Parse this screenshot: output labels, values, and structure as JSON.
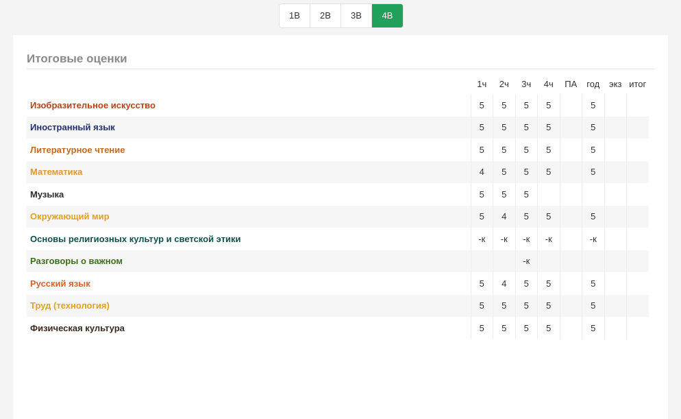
{
  "tabs": [
    {
      "label": "1В",
      "active": false
    },
    {
      "label": "2В",
      "active": false
    },
    {
      "label": "3В",
      "active": false
    },
    {
      "label": "4В",
      "active": true
    }
  ],
  "colors": {
    "accent": "#20a05a",
    "card_title": "#8a8a8a"
  },
  "grades": {
    "title": "Итоговые оценки",
    "columns": [
      "1ч",
      "2ч",
      "3ч",
      "4ч",
      "ПА",
      "год",
      "экз",
      "итог"
    ],
    "rows": [
      {
        "subject": "Изобразительное искусство",
        "color": "#b7421a",
        "marks": [
          "5",
          "5",
          "5",
          "5",
          "",
          "5",
          "",
          ""
        ]
      },
      {
        "subject": "Иностранный язык",
        "color": "#23306e",
        "marks": [
          "5",
          "5",
          "5",
          "5",
          "",
          "5",
          "",
          ""
        ]
      },
      {
        "subject": "Литературное чтение",
        "color": "#c66a1d",
        "marks": [
          "5",
          "5",
          "5",
          "5",
          "",
          "5",
          "",
          ""
        ]
      },
      {
        "subject": "Математика",
        "color": "#e0972f",
        "marks": [
          "4",
          "5",
          "5",
          "5",
          "",
          "5",
          "",
          ""
        ]
      },
      {
        "subject": "Музыка",
        "color": "#2e2e2e",
        "marks": [
          "5",
          "5",
          "5",
          "",
          "",
          "",
          "",
          ""
        ]
      },
      {
        "subject": "Окружающий мир",
        "color": "#e2a11e",
        "marks": [
          "5",
          "4",
          "5",
          "5",
          "",
          "5",
          "",
          ""
        ]
      },
      {
        "subject": "Основы религиозных культур и светской этики",
        "color": "#0f4f4f",
        "marks": [
          "-к",
          "-к",
          "-к",
          "-к",
          "",
          "-к",
          "",
          ""
        ]
      },
      {
        "subject": "Разговоры о важном",
        "color": "#3f6e1d",
        "marks": [
          "",
          "",
          "-к",
          "",
          "",
          "",
          "",
          ""
        ]
      },
      {
        "subject": "Русский язык",
        "color": "#d9622b",
        "marks": [
          "5",
          "4",
          "5",
          "5",
          "",
          "5",
          "",
          ""
        ]
      },
      {
        "subject": "Труд (технология)",
        "color": "#e2a11e",
        "marks": [
          "5",
          "5",
          "5",
          "5",
          "",
          "5",
          "",
          ""
        ]
      },
      {
        "subject": "Физическая культура",
        "color": "#3a2a22",
        "marks": [
          "5",
          "5",
          "5",
          "5",
          "",
          "5",
          "",
          ""
        ]
      }
    ]
  }
}
